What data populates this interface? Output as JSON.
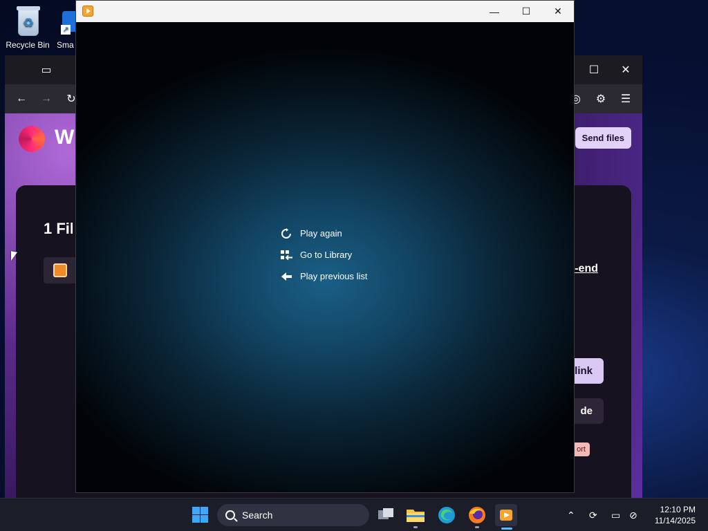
{
  "desktop": {
    "icons": [
      {
        "label": "Recycle Bin",
        "icon": "recycle-bin-icon"
      },
      {
        "label": "Sma",
        "icon": "shortcut-icon"
      }
    ]
  },
  "browser": {
    "brand_text": "W",
    "send_files_label": "Send files",
    "panel_title": "1 Fil",
    "right_link": "-end",
    "link_button": "link",
    "code_button": "de",
    "report_badge": "ort"
  },
  "player": {
    "menu": [
      {
        "label": "Play again",
        "icon": "replay-icon"
      },
      {
        "label": "Go to Library",
        "icon": "library-icon"
      },
      {
        "label": "Play previous list",
        "icon": "back-arrow-icon"
      }
    ]
  },
  "taskbar": {
    "search_label": "Search",
    "time": "12:10 PM",
    "date": "11/14/2025"
  },
  "colors": {
    "accent": "#4cc2ff",
    "player_glow": "#1a5f86",
    "send_files_bg": "#e3d2f7"
  }
}
